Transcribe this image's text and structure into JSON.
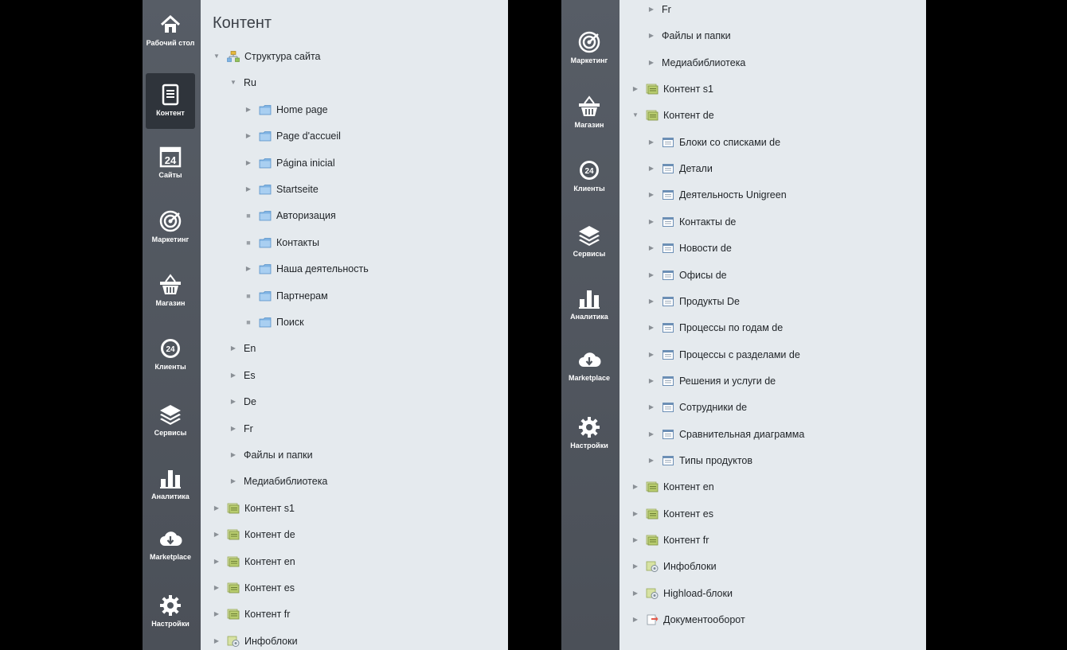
{
  "left_panel": {
    "title": "Контент",
    "nav": [
      {
        "icon": "home-icon",
        "label": "Рабочий стол"
      },
      {
        "icon": "document-icon",
        "label": "Контент",
        "active": true
      },
      {
        "icon": "calendar-24-icon",
        "label": "Сайты"
      },
      {
        "icon": "target-icon",
        "label": "Маркетинг"
      },
      {
        "icon": "basket-icon",
        "label": "Магазин"
      },
      {
        "icon": "clients-24-icon",
        "label": "Клиенты"
      },
      {
        "icon": "layers-icon",
        "label": "Сервисы"
      },
      {
        "icon": "bar-chart-icon",
        "label": "Аналитика"
      },
      {
        "icon": "cloud-download-icon",
        "label": "Marketplace"
      },
      {
        "icon": "gear-icon",
        "label": "Настройки"
      }
    ],
    "tree": [
      {
        "label": "Структура сайта",
        "level": 0,
        "state": "expanded",
        "icon": "sitemap-icon"
      },
      {
        "label": "Ru",
        "level": 1,
        "state": "expanded",
        "icon": "none"
      },
      {
        "label": "Home page",
        "level": 2,
        "state": "collapsed",
        "icon": "folder-icon"
      },
      {
        "label": "Page d'accueil",
        "level": 2,
        "state": "collapsed",
        "icon": "folder-icon"
      },
      {
        "label": "Página inicial",
        "level": 2,
        "state": "collapsed",
        "icon": "folder-icon"
      },
      {
        "label": "Startseite",
        "level": 2,
        "state": "collapsed",
        "icon": "folder-icon"
      },
      {
        "label": "Авторизация",
        "level": 2,
        "state": "leaf",
        "icon": "folder-icon"
      },
      {
        "label": "Контакты",
        "level": 2,
        "state": "leaf",
        "icon": "folder-icon"
      },
      {
        "label": "Наша деятельность",
        "level": 2,
        "state": "collapsed",
        "icon": "folder-icon"
      },
      {
        "label": "Партнерам",
        "level": 2,
        "state": "leaf",
        "icon": "folder-icon"
      },
      {
        "label": "Поиск",
        "level": 2,
        "state": "leaf",
        "icon": "folder-icon"
      },
      {
        "label": "En",
        "level": 1,
        "state": "collapsed",
        "icon": "none"
      },
      {
        "label": "Es",
        "level": 1,
        "state": "collapsed",
        "icon": "none"
      },
      {
        "label": "De",
        "level": 1,
        "state": "collapsed",
        "icon": "none"
      },
      {
        "label": "Fr",
        "level": 1,
        "state": "collapsed",
        "icon": "none"
      },
      {
        "label": "Файлы и папки",
        "level": 1,
        "state": "collapsed",
        "icon": "none"
      },
      {
        "label": "Медиабиблиотека",
        "level": 1,
        "state": "collapsed",
        "icon": "none"
      },
      {
        "label": "Контент s1",
        "level": 0,
        "state": "collapsed",
        "icon": "content-icon"
      },
      {
        "label": "Контент de",
        "level": 0,
        "state": "collapsed",
        "icon": "content-icon"
      },
      {
        "label": "Контент en",
        "level": 0,
        "state": "collapsed",
        "icon": "content-icon"
      },
      {
        "label": "Контент es",
        "level": 0,
        "state": "collapsed",
        "icon": "content-icon"
      },
      {
        "label": "Контент fr",
        "level": 0,
        "state": "collapsed",
        "icon": "content-icon"
      },
      {
        "label": "Инфоблоки",
        "level": 0,
        "state": "collapsed",
        "icon": "iblock-icon"
      }
    ]
  },
  "right_panel": {
    "nav": [
      {
        "icon": "target-icon",
        "label": "Маркетинг"
      },
      {
        "icon": "basket-icon",
        "label": "Магазин"
      },
      {
        "icon": "clients-24-icon",
        "label": "Клиенты"
      },
      {
        "icon": "layers-icon",
        "label": "Сервисы"
      },
      {
        "icon": "bar-chart-icon",
        "label": "Аналитика"
      },
      {
        "icon": "cloud-download-icon",
        "label": "Marketplace"
      },
      {
        "icon": "gear-icon",
        "label": "Настройки"
      }
    ],
    "tree": [
      {
        "label": "Fr",
        "level": 1,
        "state": "collapsed",
        "icon": "none"
      },
      {
        "label": "Файлы и папки",
        "level": 1,
        "state": "collapsed",
        "icon": "none"
      },
      {
        "label": "Медиабиблиотека",
        "level": 1,
        "state": "collapsed",
        "icon": "none"
      },
      {
        "label": "Контент s1",
        "level": 0,
        "state": "collapsed",
        "icon": "content-icon"
      },
      {
        "label": "Контент de",
        "level": 0,
        "state": "expanded",
        "icon": "content-icon"
      },
      {
        "label": "Блоки со списками de",
        "level": 1,
        "state": "collapsed",
        "icon": "list-block-icon"
      },
      {
        "label": "Детали",
        "level": 1,
        "state": "collapsed",
        "icon": "list-block-icon"
      },
      {
        "label": "Деятельность Unigreen",
        "level": 1,
        "state": "collapsed",
        "icon": "list-block-icon"
      },
      {
        "label": "Контакты de",
        "level": 1,
        "state": "collapsed",
        "icon": "list-block-icon"
      },
      {
        "label": "Новости de",
        "level": 1,
        "state": "collapsed",
        "icon": "list-block-icon"
      },
      {
        "label": "Офисы de",
        "level": 1,
        "state": "collapsed",
        "icon": "list-block-icon"
      },
      {
        "label": "Продукты De",
        "level": 1,
        "state": "collapsed",
        "icon": "list-block-icon"
      },
      {
        "label": "Процессы по годам de",
        "level": 1,
        "state": "collapsed",
        "icon": "list-block-icon"
      },
      {
        "label": "Процессы с разделами de",
        "level": 1,
        "state": "collapsed",
        "icon": "list-block-icon"
      },
      {
        "label": "Решения и услуги de",
        "level": 1,
        "state": "collapsed",
        "icon": "list-block-icon"
      },
      {
        "label": "Сотрудники de",
        "level": 1,
        "state": "collapsed",
        "icon": "list-block-icon"
      },
      {
        "label": "Сравнительная диаграмма",
        "level": 1,
        "state": "collapsed",
        "icon": "list-block-icon"
      },
      {
        "label": "Типы продуктов",
        "level": 1,
        "state": "collapsed",
        "icon": "list-block-icon"
      },
      {
        "label": "Контент en",
        "level": 0,
        "state": "collapsed",
        "icon": "content-icon"
      },
      {
        "label": "Контент es",
        "level": 0,
        "state": "collapsed",
        "icon": "content-icon"
      },
      {
        "label": "Контент fr",
        "level": 0,
        "state": "collapsed",
        "icon": "content-icon"
      },
      {
        "label": "Инфоблоки",
        "level": 0,
        "state": "collapsed",
        "icon": "iblock-icon"
      },
      {
        "label": "Highload-блоки",
        "level": 0,
        "state": "collapsed",
        "icon": "iblock-icon"
      },
      {
        "label": "Документооборот",
        "level": 0,
        "state": "collapsed",
        "icon": "workflow-icon"
      }
    ]
  }
}
